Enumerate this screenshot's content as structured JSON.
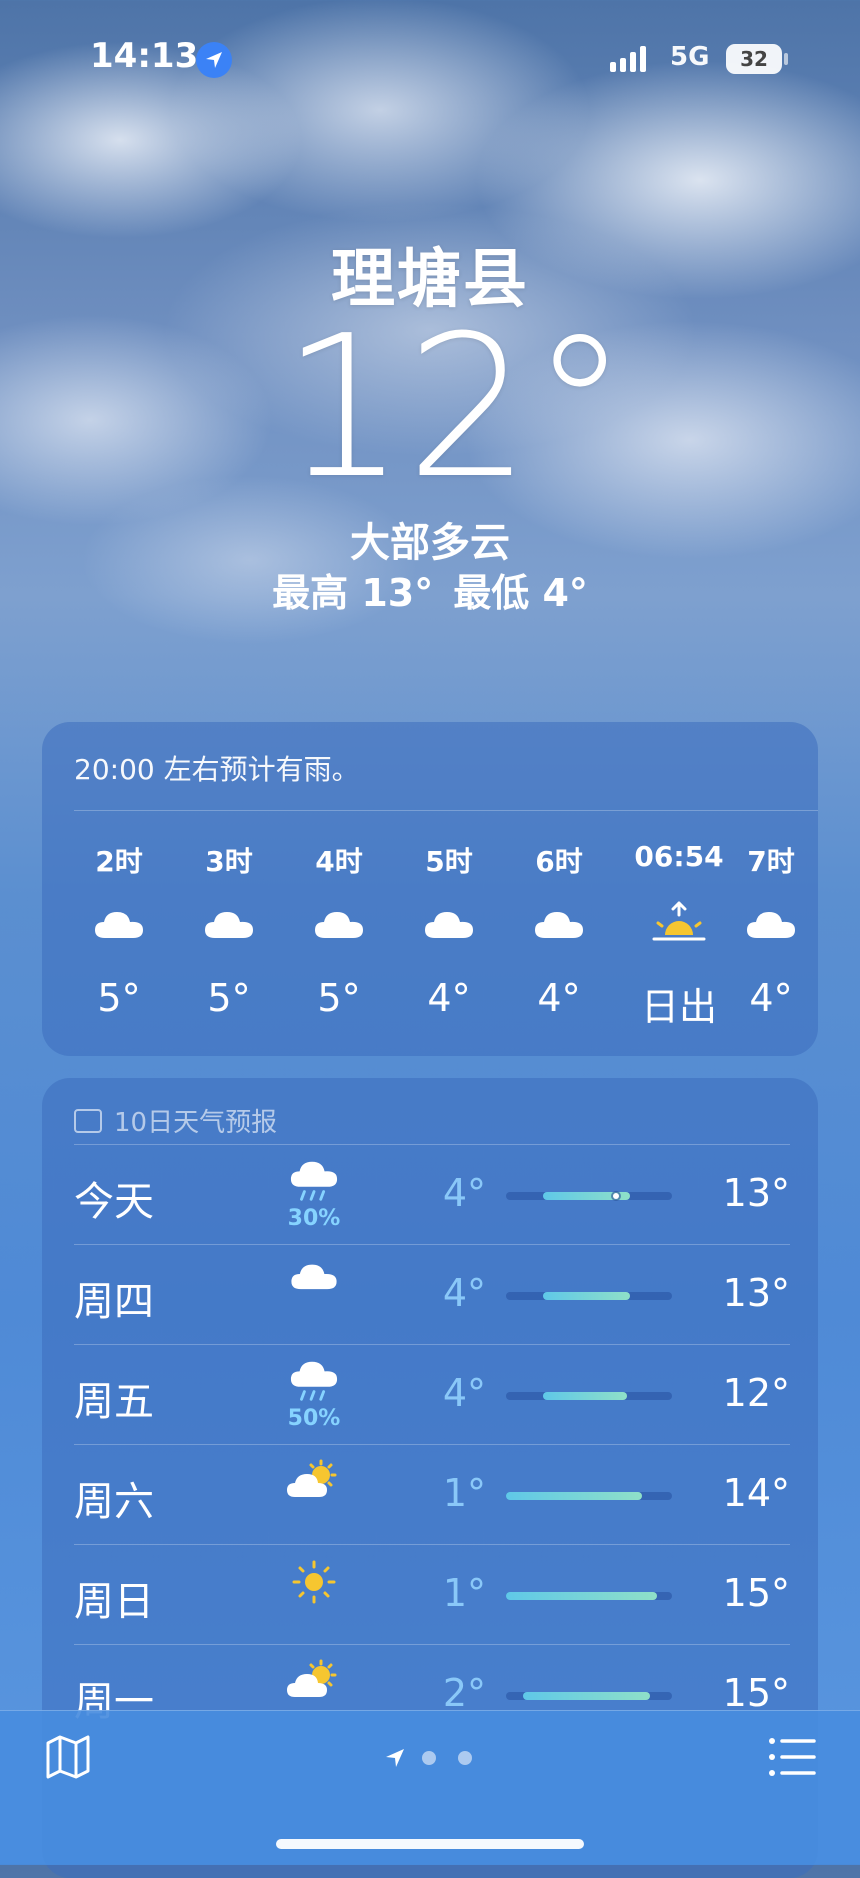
{
  "status_bar": {
    "time": "14:13",
    "network": "5G",
    "battery": "32"
  },
  "header": {
    "city": "理塘县",
    "temperature": "12°",
    "condition": "大部多云",
    "high": "最高 13°",
    "low": "最低 4°"
  },
  "hourly": {
    "note": "20:00 左右预计有雨。",
    "items": [
      {
        "label": "2时",
        "icon": "cloud-icon",
        "temp": "5°"
      },
      {
        "label": "3时",
        "icon": "cloud-icon",
        "temp": "5°"
      },
      {
        "label": "4时",
        "icon": "cloud-icon",
        "temp": "5°"
      },
      {
        "label": "5时",
        "icon": "cloud-icon",
        "temp": "4°"
      },
      {
        "label": "6时",
        "icon": "cloud-icon",
        "temp": "4°"
      },
      {
        "label": "06:54",
        "icon": "sunrise-icon",
        "temp": "日出"
      },
      {
        "label": "7时",
        "icon": "cloud-icon",
        "temp": "4°"
      }
    ]
  },
  "daily": {
    "title": "10日天气预报",
    "items": [
      {
        "day": "今天",
        "icon": "rain-icon",
        "pop": "30%",
        "low": "4°",
        "high": "13°",
        "bar_start": 0.22,
        "bar_end": 0.75,
        "current": 0.66
      },
      {
        "day": "周四",
        "icon": "cloud-icon",
        "pop": "",
        "low": "4°",
        "high": "13°",
        "bar_start": 0.22,
        "bar_end": 0.75
      },
      {
        "day": "周五",
        "icon": "rain-icon",
        "pop": "50%",
        "low": "4°",
        "high": "12°",
        "bar_start": 0.22,
        "bar_end": 0.73
      },
      {
        "day": "周六",
        "icon": "partly-sunny-icon",
        "pop": "",
        "low": "1°",
        "high": "14°",
        "bar_start": 0.0,
        "bar_end": 0.82
      },
      {
        "day": "周日",
        "icon": "sun-icon",
        "pop": "",
        "low": "1°",
        "high": "15°",
        "bar_start": 0.0,
        "bar_end": 0.91
      },
      {
        "day": "周一",
        "icon": "partly-sunny-icon",
        "pop": "",
        "low": "2°",
        "high": "15°",
        "bar_start": 0.1,
        "bar_end": 0.87
      }
    ]
  },
  "toolbar": {
    "map_icon": "map-icon",
    "list_icon": "list-icon",
    "pages": 2
  }
}
